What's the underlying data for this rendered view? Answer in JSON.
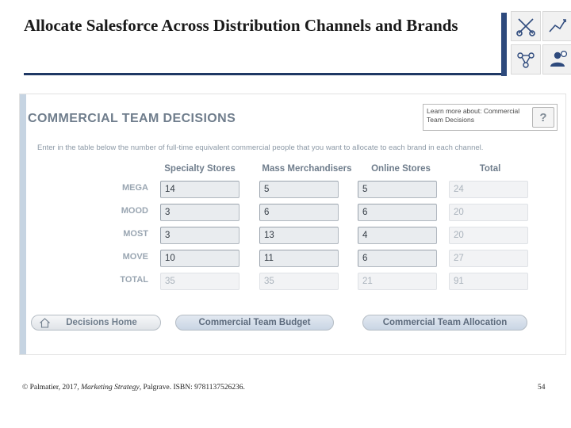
{
  "slide": {
    "title": "Allocate Salesforce Across Distribution Channels and Brands",
    "footer_prefix": "© Palmatier, 2017, ",
    "footer_italic": "Marketing Strategy",
    "footer_suffix": ", Palgrave. ISBN: 9781137526236.",
    "page_number": "54"
  },
  "app": {
    "heading": "COMMERCIAL TEAM DECISIONS",
    "help_text": "Learn more about: Commercial Team Decisions",
    "help_button": "?",
    "instruction": "Enter in the table below the number of full-time equivalent commercial people that you want to allocate to each brand in each channel.",
    "table": {
      "column_headers": [
        "Specialty Stores",
        "Mass Merchandisers",
        "Online Stores",
        "Total"
      ],
      "row_labels": [
        "MEGA",
        "MOOD",
        "MOST",
        "MOVE",
        "TOTAL"
      ],
      "rows": [
        {
          "label": "MEGA",
          "values": [
            "14",
            "5",
            "5"
          ],
          "total": "24"
        },
        {
          "label": "MOOD",
          "values": [
            "3",
            "6",
            "6"
          ],
          "total": "20"
        },
        {
          "label": "MOST",
          "values": [
            "3",
            "13",
            "4"
          ],
          "total": "20"
        },
        {
          "label": "MOVE",
          "values": [
            "10",
            "11",
            "6"
          ],
          "total": "27"
        }
      ],
      "totals_row": {
        "label": "TOTAL",
        "values": [
          "35",
          "35",
          "21"
        ],
        "total": "91"
      }
    },
    "buttons": {
      "home": "Decisions Home",
      "budget": "Commercial Team Budget",
      "allocation": "Commercial Team Allocation"
    }
  },
  "icons": {
    "top_left": "scissors-icon",
    "top_right": "line-chart-icon",
    "bottom_left": "network-icon",
    "bottom_right": "user-gear-icon",
    "home": "home-icon"
  },
  "colors": {
    "rule": "#1f3864",
    "accent_bar": "#2e4a7d",
    "panel_strip": "#c6d4e2",
    "heading": "#6f7d8c"
  }
}
